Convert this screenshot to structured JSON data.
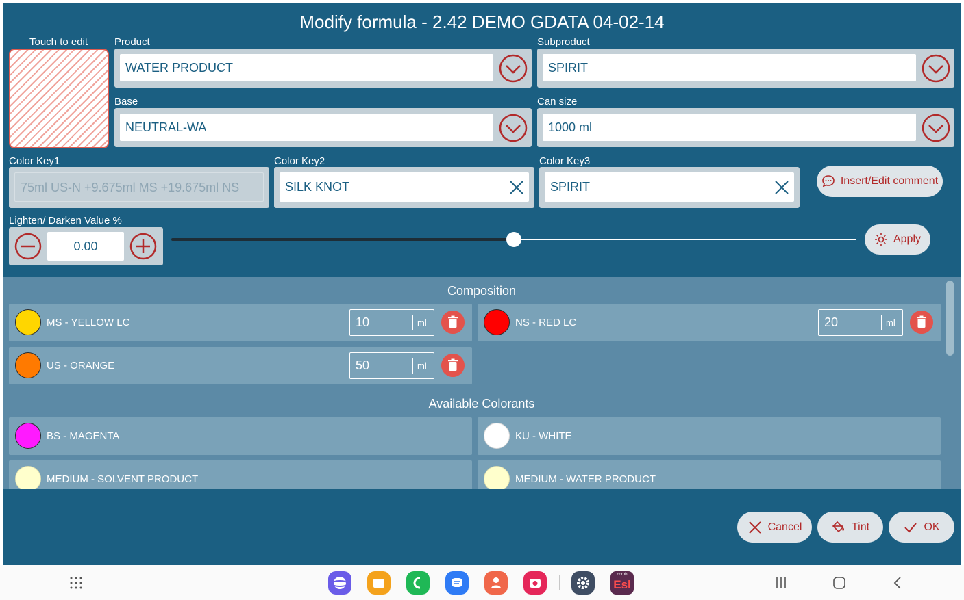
{
  "title": "Modify formula - 2.42  DEMO GDATA 04-02-14",
  "swatch_label": "Touch to edit",
  "product": {
    "label": "Product",
    "value": "WATER PRODUCT"
  },
  "subproduct": {
    "label": "Subproduct",
    "value": "SPIRIT"
  },
  "base": {
    "label": "Base",
    "value": "NEUTRAL-WA"
  },
  "can_size": {
    "label": "Can size",
    "value": "1000 ml"
  },
  "color_key1": {
    "label": "Color Key1",
    "value": "75ml US-N +9.675ml MS +19.675ml NS"
  },
  "color_key2": {
    "label": "Color Key2",
    "value": "SILK KNOT"
  },
  "color_key3": {
    "label": "Color Key3",
    "value": "SPIRIT"
  },
  "comment_button": "Insert/Edit comment",
  "lighten": {
    "label": "Lighten/ Darken Value %",
    "value": "0.00",
    "slider_level": 0.5
  },
  "apply_button": "Apply",
  "composition": {
    "header": "Composition",
    "items": [
      {
        "name": "MS - YELLOW LC",
        "qty": "10",
        "unit": "ml",
        "color": "#ffd600"
      },
      {
        "name": "NS - RED LC",
        "qty": "20",
        "unit": "ml",
        "color": "#ff0000"
      },
      {
        "name": "US - ORANGE",
        "qty": "50",
        "unit": "ml",
        "color": "#ff7a00"
      }
    ]
  },
  "available": {
    "header": "Available Colorants",
    "items": [
      {
        "name": "BS - MAGENTA",
        "color": "#ff1aff"
      },
      {
        "name": "KU - WHITE",
        "color": "#ffffff"
      },
      {
        "name": "MEDIUM - SOLVENT PRODUCT",
        "color": "#ffffcc"
      },
      {
        "name": "MEDIUM - WATER PRODUCT",
        "color": "#ffffcc"
      }
    ]
  },
  "footer": {
    "cancel": "Cancel",
    "tint": "Tint",
    "ok": "OK"
  },
  "taskbar": {
    "esl_small": "corob",
    "esl_label": "Esl"
  },
  "colors": {
    "background": "#1b5f82",
    "panel": "#5c8aa6",
    "accent": "#b22a2a"
  }
}
